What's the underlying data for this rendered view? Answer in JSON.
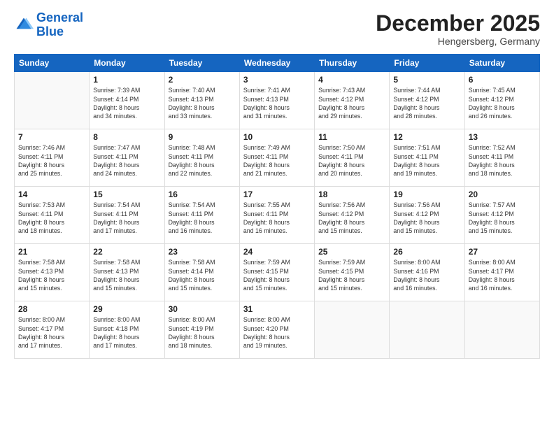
{
  "logo": {
    "line1": "General",
    "line2": "Blue"
  },
  "title": "December 2025",
  "subtitle": "Hengersberg, Germany",
  "days_header": [
    "Sunday",
    "Monday",
    "Tuesday",
    "Wednesday",
    "Thursday",
    "Friday",
    "Saturday"
  ],
  "weeks": [
    [
      {
        "day": "",
        "info": ""
      },
      {
        "day": "1",
        "info": "Sunrise: 7:39 AM\nSunset: 4:14 PM\nDaylight: 8 hours\nand 34 minutes."
      },
      {
        "day": "2",
        "info": "Sunrise: 7:40 AM\nSunset: 4:13 PM\nDaylight: 8 hours\nand 33 minutes."
      },
      {
        "day": "3",
        "info": "Sunrise: 7:41 AM\nSunset: 4:13 PM\nDaylight: 8 hours\nand 31 minutes."
      },
      {
        "day": "4",
        "info": "Sunrise: 7:43 AM\nSunset: 4:12 PM\nDaylight: 8 hours\nand 29 minutes."
      },
      {
        "day": "5",
        "info": "Sunrise: 7:44 AM\nSunset: 4:12 PM\nDaylight: 8 hours\nand 28 minutes."
      },
      {
        "day": "6",
        "info": "Sunrise: 7:45 AM\nSunset: 4:12 PM\nDaylight: 8 hours\nand 26 minutes."
      }
    ],
    [
      {
        "day": "7",
        "info": "Sunrise: 7:46 AM\nSunset: 4:11 PM\nDaylight: 8 hours\nand 25 minutes."
      },
      {
        "day": "8",
        "info": "Sunrise: 7:47 AM\nSunset: 4:11 PM\nDaylight: 8 hours\nand 24 minutes."
      },
      {
        "day": "9",
        "info": "Sunrise: 7:48 AM\nSunset: 4:11 PM\nDaylight: 8 hours\nand 22 minutes."
      },
      {
        "day": "10",
        "info": "Sunrise: 7:49 AM\nSunset: 4:11 PM\nDaylight: 8 hours\nand 21 minutes."
      },
      {
        "day": "11",
        "info": "Sunrise: 7:50 AM\nSunset: 4:11 PM\nDaylight: 8 hours\nand 20 minutes."
      },
      {
        "day": "12",
        "info": "Sunrise: 7:51 AM\nSunset: 4:11 PM\nDaylight: 8 hours\nand 19 minutes."
      },
      {
        "day": "13",
        "info": "Sunrise: 7:52 AM\nSunset: 4:11 PM\nDaylight: 8 hours\nand 18 minutes."
      }
    ],
    [
      {
        "day": "14",
        "info": "Sunrise: 7:53 AM\nSunset: 4:11 PM\nDaylight: 8 hours\nand 18 minutes."
      },
      {
        "day": "15",
        "info": "Sunrise: 7:54 AM\nSunset: 4:11 PM\nDaylight: 8 hours\nand 17 minutes."
      },
      {
        "day": "16",
        "info": "Sunrise: 7:54 AM\nSunset: 4:11 PM\nDaylight: 8 hours\nand 16 minutes."
      },
      {
        "day": "17",
        "info": "Sunrise: 7:55 AM\nSunset: 4:11 PM\nDaylight: 8 hours\nand 16 minutes."
      },
      {
        "day": "18",
        "info": "Sunrise: 7:56 AM\nSunset: 4:12 PM\nDaylight: 8 hours\nand 15 minutes."
      },
      {
        "day": "19",
        "info": "Sunrise: 7:56 AM\nSunset: 4:12 PM\nDaylight: 8 hours\nand 15 minutes."
      },
      {
        "day": "20",
        "info": "Sunrise: 7:57 AM\nSunset: 4:12 PM\nDaylight: 8 hours\nand 15 minutes."
      }
    ],
    [
      {
        "day": "21",
        "info": "Sunrise: 7:58 AM\nSunset: 4:13 PM\nDaylight: 8 hours\nand 15 minutes."
      },
      {
        "day": "22",
        "info": "Sunrise: 7:58 AM\nSunset: 4:13 PM\nDaylight: 8 hours\nand 15 minutes."
      },
      {
        "day": "23",
        "info": "Sunrise: 7:58 AM\nSunset: 4:14 PM\nDaylight: 8 hours\nand 15 minutes."
      },
      {
        "day": "24",
        "info": "Sunrise: 7:59 AM\nSunset: 4:15 PM\nDaylight: 8 hours\nand 15 minutes."
      },
      {
        "day": "25",
        "info": "Sunrise: 7:59 AM\nSunset: 4:15 PM\nDaylight: 8 hours\nand 15 minutes."
      },
      {
        "day": "26",
        "info": "Sunrise: 8:00 AM\nSunset: 4:16 PM\nDaylight: 8 hours\nand 16 minutes."
      },
      {
        "day": "27",
        "info": "Sunrise: 8:00 AM\nSunset: 4:17 PM\nDaylight: 8 hours\nand 16 minutes."
      }
    ],
    [
      {
        "day": "28",
        "info": "Sunrise: 8:00 AM\nSunset: 4:17 PM\nDaylight: 8 hours\nand 17 minutes."
      },
      {
        "day": "29",
        "info": "Sunrise: 8:00 AM\nSunset: 4:18 PM\nDaylight: 8 hours\nand 17 minutes."
      },
      {
        "day": "30",
        "info": "Sunrise: 8:00 AM\nSunset: 4:19 PM\nDaylight: 8 hours\nand 18 minutes."
      },
      {
        "day": "31",
        "info": "Sunrise: 8:00 AM\nSunset: 4:20 PM\nDaylight: 8 hours\nand 19 minutes."
      },
      {
        "day": "",
        "info": ""
      },
      {
        "day": "",
        "info": ""
      },
      {
        "day": "",
        "info": ""
      }
    ]
  ]
}
